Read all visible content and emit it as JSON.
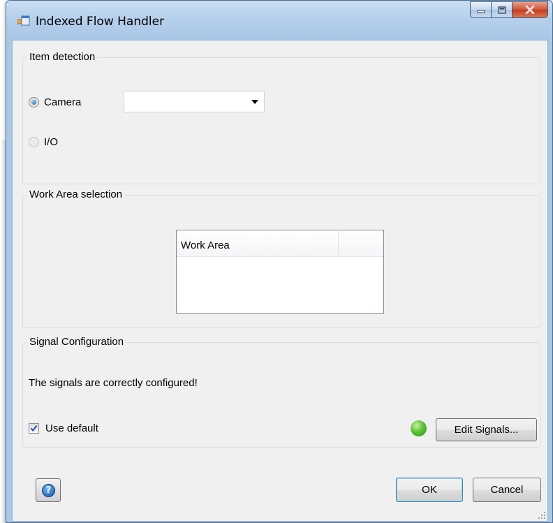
{
  "window": {
    "title": "Indexed Flow Handler",
    "icon": "app-window-icon"
  },
  "item_detection": {
    "title": "Item detection",
    "camera_label": "Camera",
    "camera_checked": true,
    "io_label": "I/O",
    "io_checked": false,
    "camera_select_value": ""
  },
  "work_area_selection": {
    "title": "Work Area selection",
    "columns": [
      "Work Area",
      ""
    ],
    "rows": []
  },
  "signal_configuration": {
    "title": "Signal Configuration",
    "status_text": "The signals are correctly configured!",
    "use_default_label": "Use default",
    "use_default_checked": true,
    "status_led_color": "#4fb82a",
    "edit_signals_label": "Edit Signals..."
  },
  "footer": {
    "help_icon": "help-icon",
    "ok_label": "OK",
    "cancel_label": "Cancel"
  }
}
